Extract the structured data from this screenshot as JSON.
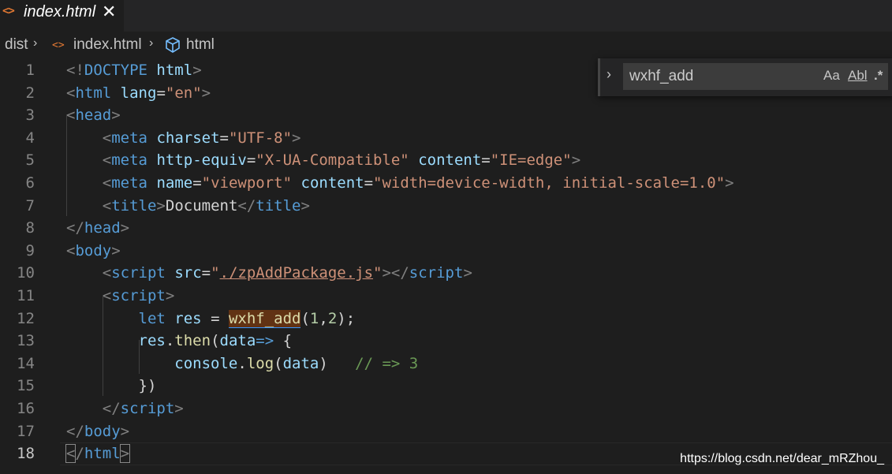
{
  "tab": {
    "label": "index.html",
    "icon": "code-file-icon",
    "close": "✕"
  },
  "breadcrumb": {
    "items": [
      "dist",
      "index.html",
      "html"
    ]
  },
  "find": {
    "value": "wxhf_add",
    "options": [
      "Aa",
      "Abl",
      ".*"
    ]
  },
  "editor": {
    "active_line": 18,
    "lines": [
      [
        [
          "tb",
          "<!"
        ],
        [
          "tg",
          "DOCTYPE"
        ],
        [
          "tx",
          " "
        ],
        [
          "at",
          "html"
        ],
        [
          "tb",
          ">"
        ]
      ],
      [
        [
          "tb",
          "<"
        ],
        [
          "tg",
          "html"
        ],
        [
          "tx",
          " "
        ],
        [
          "at",
          "lang"
        ],
        [
          "tx",
          "="
        ],
        [
          "st",
          "\"en\""
        ],
        [
          "tb",
          ">"
        ]
      ],
      [
        [
          "tb",
          "<"
        ],
        [
          "tg",
          "head"
        ],
        [
          "tb",
          ">"
        ]
      ],
      [
        [
          "tx",
          "    "
        ],
        [
          "tb",
          "<"
        ],
        [
          "tg",
          "meta"
        ],
        [
          "tx",
          " "
        ],
        [
          "at",
          "charset"
        ],
        [
          "tx",
          "="
        ],
        [
          "st",
          "\"UTF-8\""
        ],
        [
          "tb",
          ">"
        ]
      ],
      [
        [
          "tx",
          "    "
        ],
        [
          "tb",
          "<"
        ],
        [
          "tg",
          "meta"
        ],
        [
          "tx",
          " "
        ],
        [
          "at",
          "http-equiv"
        ],
        [
          "tx",
          "="
        ],
        [
          "st",
          "\"X-UA-Compatible\""
        ],
        [
          "tx",
          " "
        ],
        [
          "at",
          "content"
        ],
        [
          "tx",
          "="
        ],
        [
          "st",
          "\"IE=edge\""
        ],
        [
          "tb",
          ">"
        ]
      ],
      [
        [
          "tx",
          "    "
        ],
        [
          "tb",
          "<"
        ],
        [
          "tg",
          "meta"
        ],
        [
          "tx",
          " "
        ],
        [
          "at",
          "name"
        ],
        [
          "tx",
          "="
        ],
        [
          "st",
          "\"viewport\""
        ],
        [
          "tx",
          " "
        ],
        [
          "at",
          "content"
        ],
        [
          "tx",
          "="
        ],
        [
          "st",
          "\"width=device-width, initial-scale=1.0\""
        ],
        [
          "tb",
          ">"
        ]
      ],
      [
        [
          "tx",
          "    "
        ],
        [
          "tb",
          "<"
        ],
        [
          "tg",
          "title"
        ],
        [
          "tb",
          ">"
        ],
        [
          "tx",
          "Document"
        ],
        [
          "tb",
          "</"
        ],
        [
          "tg",
          "title"
        ],
        [
          "tb",
          ">"
        ]
      ],
      [
        [
          "tb",
          "</"
        ],
        [
          "tg",
          "head"
        ],
        [
          "tb",
          ">"
        ]
      ],
      [
        [
          "tb",
          "<"
        ],
        [
          "tg",
          "body"
        ],
        [
          "tb",
          ">"
        ]
      ],
      [
        [
          "tx",
          "    "
        ],
        [
          "tb",
          "<"
        ],
        [
          "tg",
          "script"
        ],
        [
          "tx",
          " "
        ],
        [
          "at",
          "src"
        ],
        [
          "tx",
          "="
        ],
        [
          "st",
          "\""
        ],
        [
          "st link",
          "./zpAddPackage.js"
        ],
        [
          "st",
          "\""
        ],
        [
          "tb",
          "></"
        ],
        [
          "tg",
          "script"
        ],
        [
          "tb",
          ">"
        ]
      ],
      [
        [
          "tx",
          "    "
        ],
        [
          "tb",
          "<"
        ],
        [
          "tg",
          "script"
        ],
        [
          "tb",
          ">"
        ]
      ],
      [
        [
          "tx",
          "        "
        ],
        [
          "kw",
          "let"
        ],
        [
          "tx",
          " "
        ],
        [
          "vr",
          "res"
        ],
        [
          "tx",
          " = "
        ],
        [
          "fn hl",
          "wxhf_add"
        ],
        [
          "tx",
          "("
        ],
        [
          "nm",
          "1"
        ],
        [
          "tx",
          ","
        ],
        [
          "nm",
          "2"
        ],
        [
          "tx",
          ");"
        ]
      ],
      [
        [
          "tx",
          "        "
        ],
        [
          "vr",
          "res"
        ],
        [
          "tx",
          "."
        ],
        [
          "fn",
          "then"
        ],
        [
          "tx",
          "("
        ],
        [
          "vr",
          "data"
        ],
        [
          "kw",
          "=>"
        ],
        [
          "tx",
          " {"
        ]
      ],
      [
        [
          "tx",
          "            "
        ],
        [
          "vr",
          "console"
        ],
        [
          "tx",
          "."
        ],
        [
          "fn",
          "log"
        ],
        [
          "tx",
          "("
        ],
        [
          "vr",
          "data"
        ],
        [
          "tx",
          ")   "
        ],
        [
          "cm",
          "// => 3"
        ]
      ],
      [
        [
          "tx",
          "        })"
        ]
      ],
      [
        [
          "tx",
          "    "
        ],
        [
          "tb",
          "</"
        ],
        [
          "tg",
          "script"
        ],
        [
          "tb",
          ">"
        ]
      ],
      [
        [
          "tb",
          "</"
        ],
        [
          "tg",
          "body"
        ],
        [
          "tb",
          ">"
        ]
      ],
      [
        [
          "tb match-br",
          "<"
        ],
        [
          "tb",
          "/"
        ],
        [
          "tg",
          "html"
        ],
        [
          "tb match-br",
          ">"
        ]
      ]
    ]
  },
  "watermark": "https://blog.csdn.net/dear_mRZhou_"
}
